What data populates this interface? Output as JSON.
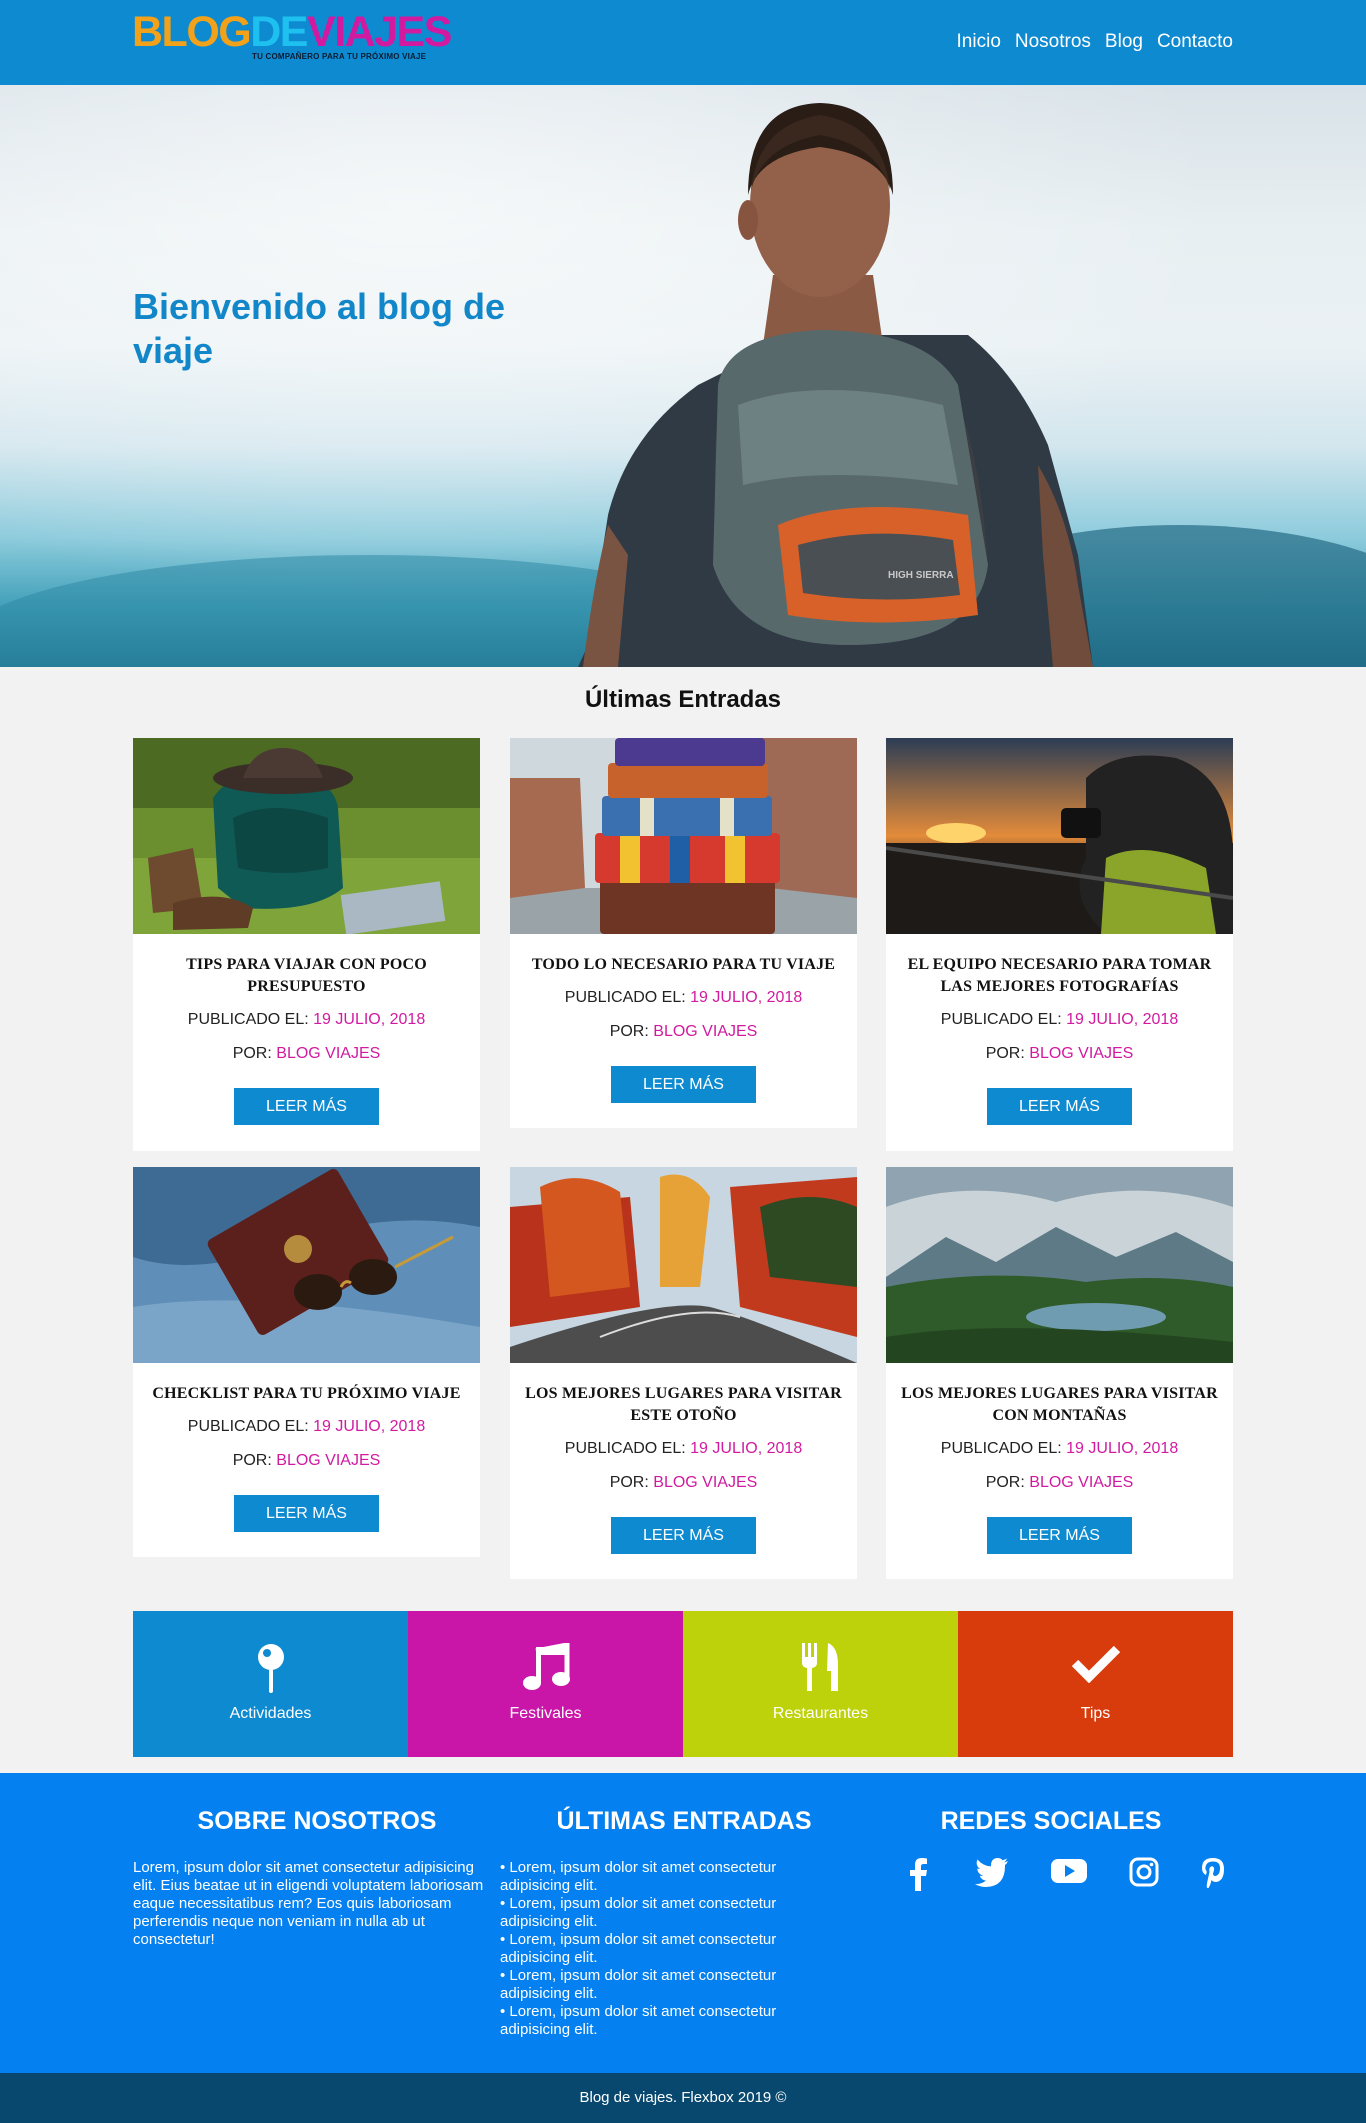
{
  "header": {
    "logo": {
      "part1": "BLOG",
      "part2": "DE",
      "part3": "VIAJES",
      "tagline": "TU COMPAÑERO PARA TU PRÓXIMO VIAJE"
    },
    "nav": [
      "Inicio",
      "Nosotros",
      "Blog",
      "Contacto"
    ]
  },
  "hero": {
    "title": "Bienvenido al blog de viaje"
  },
  "entries": {
    "title": "Últimas Entradas",
    "published_label": "PUBLICADO EL:",
    "by_label": "POR:",
    "button_label": "LEER MÁS",
    "cards": [
      {
        "title": "TIPS PARA VIAJAR CON POCO PRESUPUESTO",
        "date": "19 JULIO, 2018",
        "author": "BLOG VIAJES",
        "image": "backpack-hat-boots"
      },
      {
        "title": "TODO LO NECESARIO PARA TU VIAJE",
        "date": "19 JULIO, 2018",
        "author": "BLOG VIAJES",
        "image": "stacked-suitcases"
      },
      {
        "title": "EL EQUIPO NECESARIO PARA TOMAR LAS MEJORES FOTOGRAFÍAS",
        "date": "19 JULIO, 2018",
        "author": "BLOG VIAJES",
        "image": "photographer-sunset"
      },
      {
        "title": "CHECKLIST PARA TU PRÓXIMO VIAJE",
        "date": "19 JULIO, 2018",
        "author": "BLOG VIAJES",
        "image": "passport-sunglasses"
      },
      {
        "title": "LOS MEJORES LUGARES PARA VISITAR ESTE OTOÑO",
        "date": "19 JULIO, 2018",
        "author": "BLOG VIAJES",
        "image": "autumn-road"
      },
      {
        "title": "LOS MEJORES LUGARES PARA VISITAR CON MONTAÑAS",
        "date": "19 JULIO, 2018",
        "author": "BLOG VIAJES",
        "image": "mountain-lake"
      }
    ]
  },
  "categories": [
    {
      "label": "Actividades",
      "icon": "pin-icon",
      "color": "#0e8ad0"
    },
    {
      "label": "Festivales",
      "icon": "music-icon",
      "color": "#c916a8"
    },
    {
      "label": "Restaurantes",
      "icon": "cutlery-icon",
      "color": "#bdd20a"
    },
    {
      "label": "Tips",
      "icon": "check-icon",
      "color": "#d83b0c"
    }
  ],
  "footer": {
    "about": {
      "title": "SOBRE NOSOTROS",
      "text": "Lorem, ipsum dolor sit amet consectetur adipisicing elit. Eius beatae ut in eligendi voluptatem laboriosam eaque necessitatibus rem? Eos quis laboriosam perferendis neque non veniam in nulla ab ut consectetur!"
    },
    "latest": {
      "title": "ÚLTIMAS ENTRADAS",
      "items": [
        "Lorem, ipsum dolor sit amet consectetur adipisicing elit.",
        "Lorem, ipsum dolor sit amet consectetur adipisicing elit.",
        "Lorem, ipsum dolor sit amet consectetur adipisicing elit.",
        "Lorem, ipsum dolor sit amet consectetur adipisicing elit.",
        "Lorem, ipsum dolor sit amet consectetur adipisicing elit."
      ]
    },
    "social": {
      "title": "REDES SOCIALES",
      "icons": [
        "facebook-icon",
        "twitter-icon",
        "youtube-icon",
        "instagram-icon",
        "pinterest-icon"
      ]
    },
    "copyright": "Blog de viajes. Flexbox 2019 ©"
  },
  "colors": {
    "primary": "#0e8ad0",
    "accent": "#d11aa0",
    "footer": "#0580f0",
    "footer_bottom": "#08486f"
  }
}
